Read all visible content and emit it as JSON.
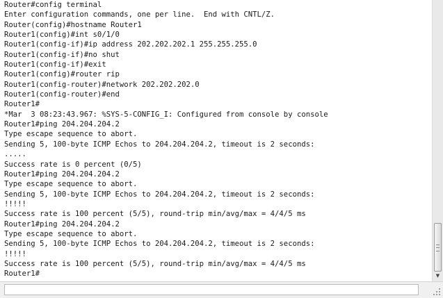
{
  "terminal": {
    "lines": [
      "Router#config terminal",
      "Enter configuration commands, one per line.  End with CNTL/Z.",
      "Router(config)#hostname Router1",
      "Router1(config)#int s0/1/0",
      "Router1(config-if)#ip address 202.202.202.1 255.255.255.0",
      "Router1(config-if)#no shut",
      "Router1(config-if)#exit",
      "Router1(config)#router rip",
      "Router1(config-router)#network 202.202.202.0",
      "Router1(config-router)#end",
      "Router1#",
      "*Mar  3 08:23:43.967: %SYS-5-CONFIG_I: Configured from console by console",
      "Router1#ping 204.204.204.2",
      "Type escape sequence to abort.",
      "Sending 5, 100-byte ICMP Echos to 204.204.204.2, timeout is 2 seconds:",
      ".....",
      "Success rate is 0 percent (0/5)",
      "Router1#ping 204.204.204.2",
      "Type escape sequence to abort.",
      "Sending 5, 100-byte ICMP Echos to 204.204.204.2, timeout is 2 seconds:",
      "!!!!!",
      "Success rate is 100 percent (5/5), round-trip min/avg/max = 4/4/5 ms",
      "Router1#ping 204.204.204.2",
      "Type escape sequence to abort.",
      "Sending 5, 100-byte ICMP Echos to 204.204.204.2, timeout is 2 seconds:",
      "!!!!!",
      "Success rate is 100 percent (5/5), round-trip min/avg/max = 4/4/5 ms",
      "Router1#"
    ]
  },
  "icons": {
    "scroll_down": "arrow-down-icon",
    "resize_grip": "resize-grip-icon"
  },
  "colors": {
    "terminal_background": "#ffffff",
    "terminal_text": "#1a1a1a",
    "scrollbar_track": "#e9e9e9"
  }
}
